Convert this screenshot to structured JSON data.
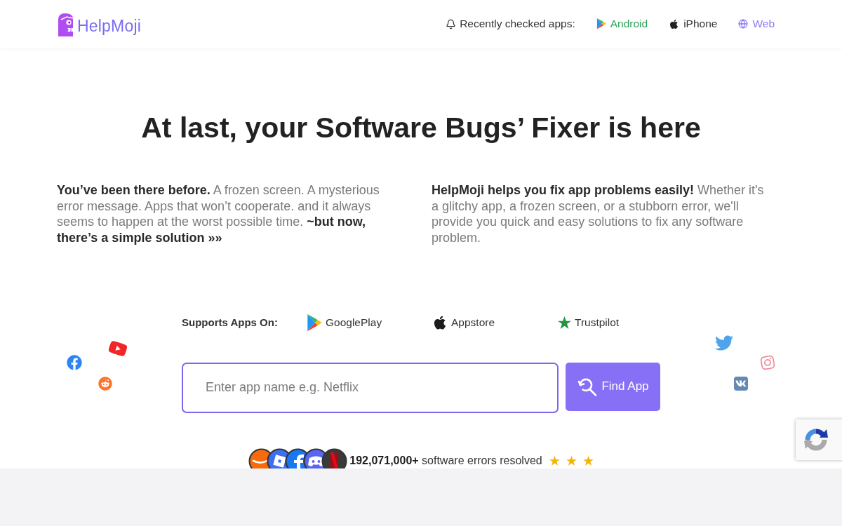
{
  "header": {
    "logo": "HelpMoji",
    "recent_label": "Recently checked apps:",
    "platforms": [
      {
        "kind": "android",
        "label": "Android"
      },
      {
        "kind": "iphone",
        "label": "iPhone"
      },
      {
        "kind": "web",
        "label": "Web"
      }
    ]
  },
  "hero": {
    "title": "At last, your Software Bugs’ Fixer is here",
    "paragraphs": [
      "**You’ve been there before.** A frozen screen. A mysterious error message. Apps that won’t cooperate. and it always seems to happen at the worst possible time. **~but now, there’s a simple solution »»**",
      "**HelpMoji helps you fix app problems easily!** Whether it's a glitchy app, a frozen screen, or a stubborn error, we'll provide you quick and easy solutions to fix any software problem."
    ]
  },
  "supports": {
    "label": "Supports Apps On:",
    "stores": [
      {
        "kind": "googleplay",
        "label": "GooglePlay"
      },
      {
        "kind": "appstore",
        "label": "Appstore"
      },
      {
        "kind": "trustpilot",
        "label": "Trustpilot"
      }
    ]
  },
  "search": {
    "placeholder": "Enter app name e.g. Netflix",
    "button": "Find App"
  },
  "stats": {
    "count": "192,071,000+",
    "label": "software errors resolved",
    "stars": 3
  }
}
